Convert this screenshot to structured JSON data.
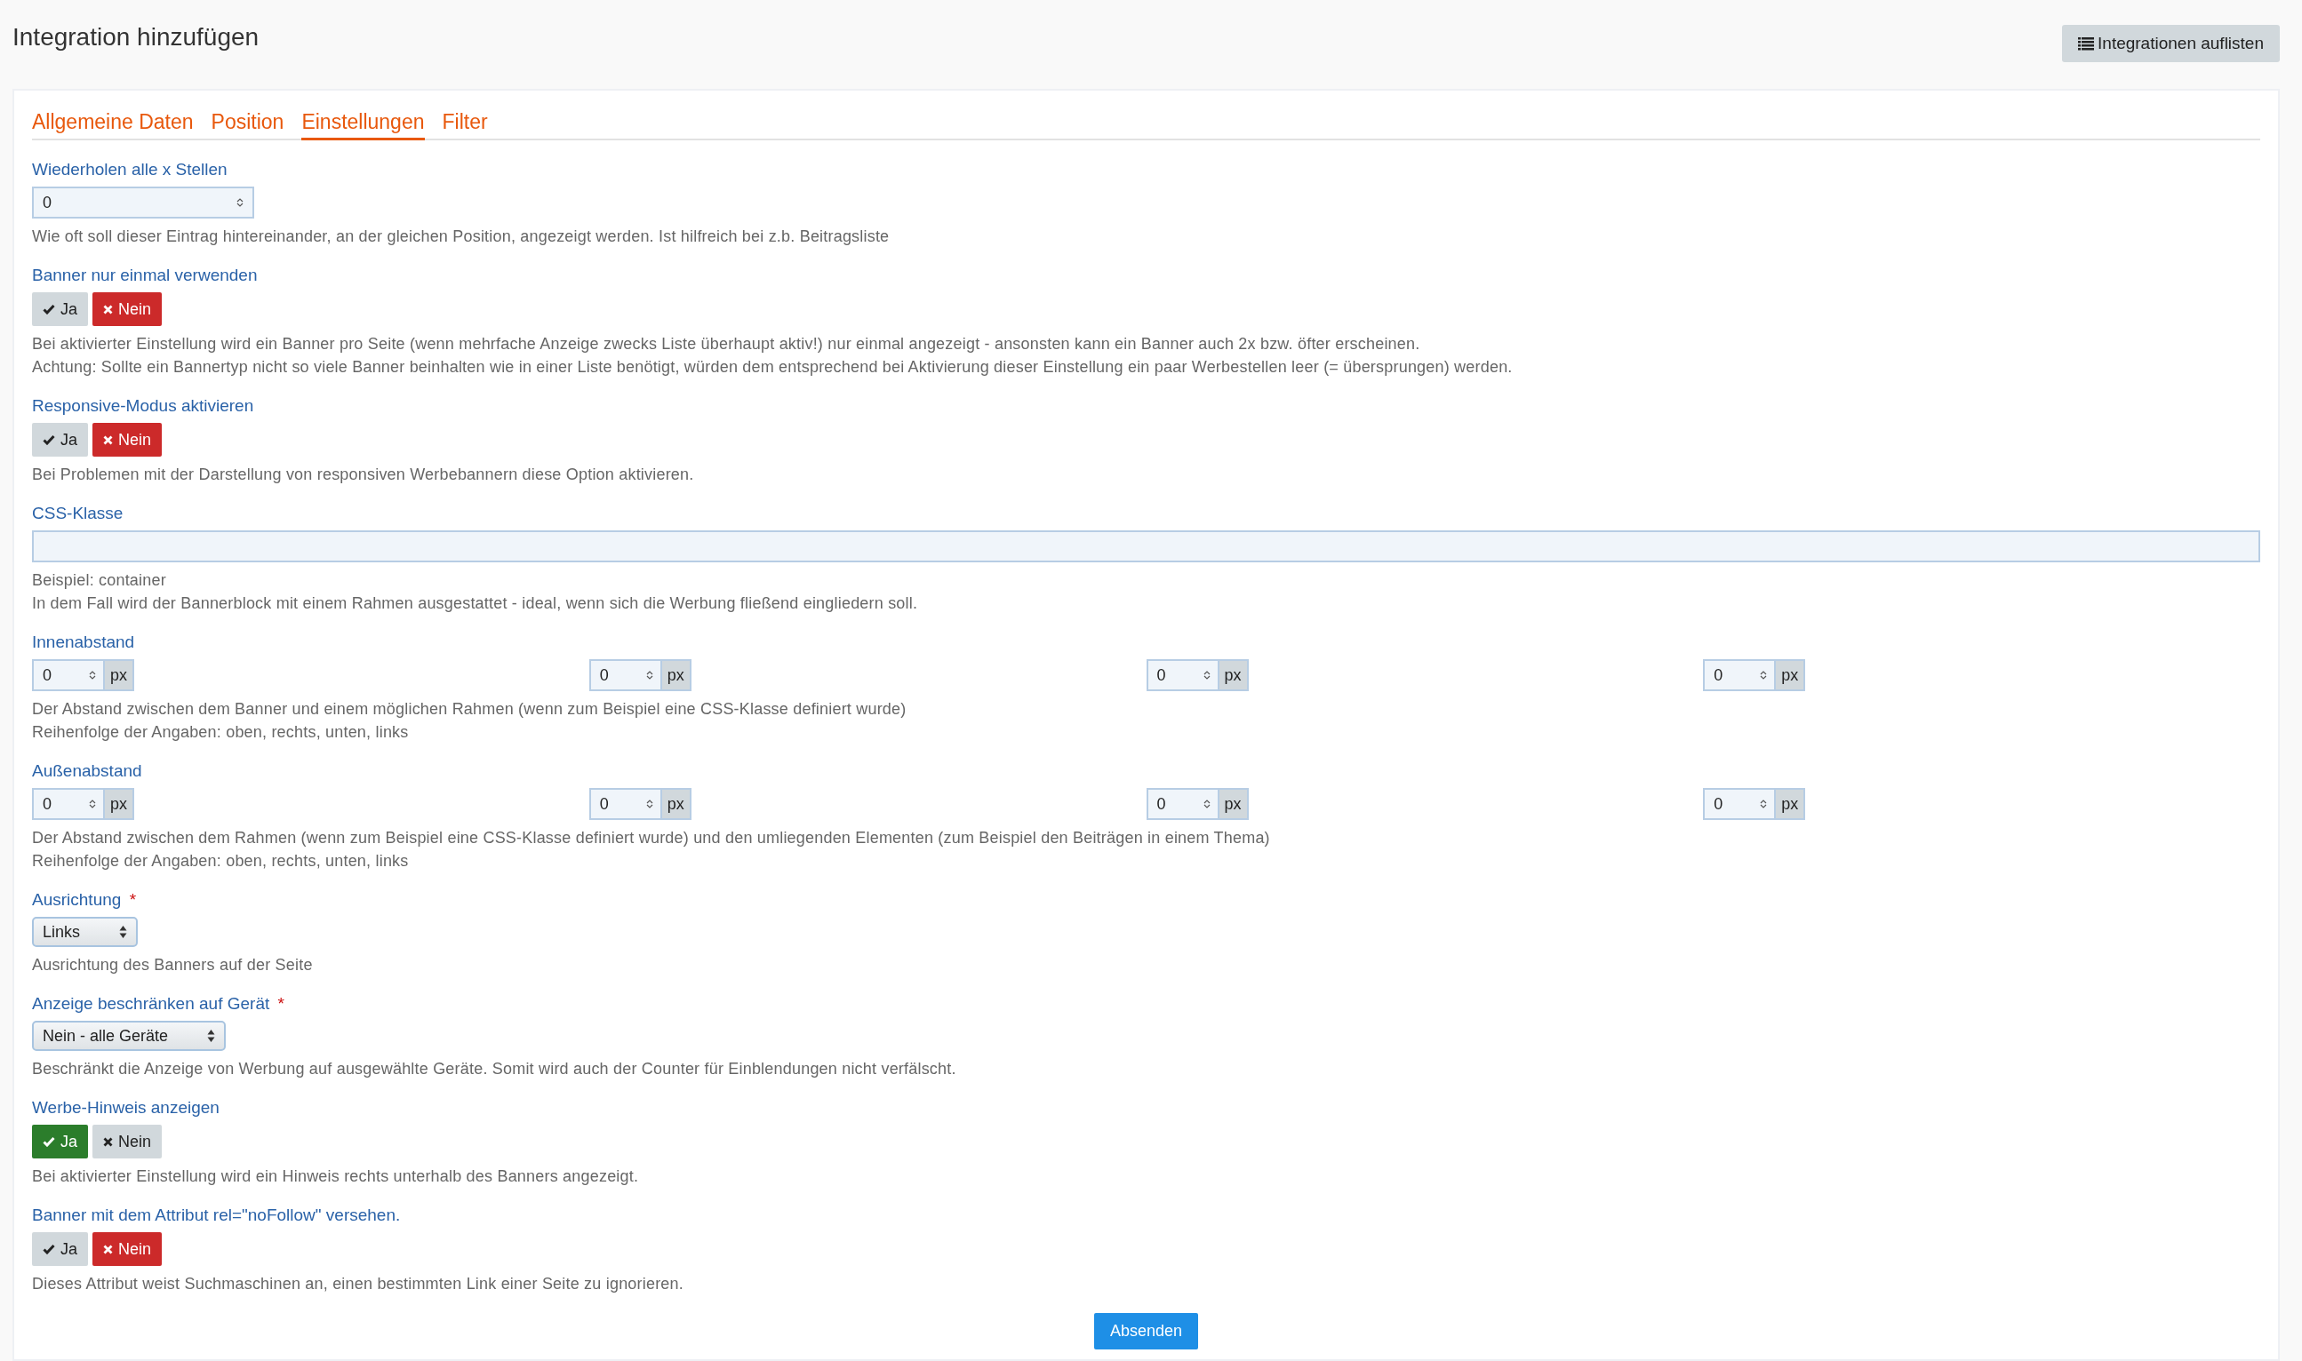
{
  "header": {
    "title": "Integration hinzufügen",
    "list_button": "Integrationen auflisten"
  },
  "tabs": [
    {
      "label": "Allgemeine Daten",
      "selected": false
    },
    {
      "label": "Position",
      "selected": false
    },
    {
      "label": "Einstellungen",
      "selected": true
    },
    {
      "label": "Filter",
      "selected": false
    }
  ],
  "fields": [
    {
      "kind": "number",
      "label": "Wiederholen alle x Stellen",
      "value": "0",
      "help": [
        "Wie oft soll dieser Eintrag hintereinander, an der gleichen Position, angezeigt werden. Ist hilfreich bei z.b. Beitragsliste"
      ]
    },
    {
      "kind": "toggle",
      "label": "Banner nur einmal verwenden",
      "options": [
        {
          "label": "Ja",
          "kind": "yes",
          "selected": false
        },
        {
          "label": "Nein",
          "kind": "no",
          "selected": true
        }
      ],
      "help": [
        "Bei aktivierter Einstellung wird ein Banner pro Seite (wenn mehrfache Anzeige zwecks Liste überhaupt aktiv!) nur einmal angezeigt - ansonsten kann ein Banner auch 2x bzw. öfter erscheinen.",
        "Achtung: Sollte ein Bannertyp nicht so viele Banner beinhalten wie in einer Liste benötigt, würden dem entsprechend bei Aktivierung dieser Einstellung ein paar Werbestellen leer (= übersprungen) werden."
      ]
    },
    {
      "kind": "toggle",
      "label": "Responsive-Modus aktivieren",
      "options": [
        {
          "label": "Ja",
          "kind": "yes",
          "selected": false
        },
        {
          "label": "Nein",
          "kind": "no",
          "selected": true
        }
      ],
      "help": [
        "Bei Problemen mit der Darstellung von responsiven Werbebannern diese Option aktivieren."
      ]
    },
    {
      "kind": "text",
      "label": "CSS-Klasse",
      "help": [
        "Beispiel: container",
        "In dem Fall wird der Bannerblock mit einem Rahmen ausgestattet - ideal, wenn sich die Werbung fließend eingliedern soll."
      ]
    },
    {
      "kind": "quad",
      "label": "Innenabstand",
      "inputs": [
        {
          "value": "0",
          "unit": "px"
        },
        {
          "value": "0",
          "unit": "px"
        },
        {
          "value": "0",
          "unit": "px"
        },
        {
          "value": "0",
          "unit": "px"
        }
      ],
      "help": [
        "Der Abstand zwischen dem Banner und einem möglichen Rahmen (wenn zum Beispiel eine CSS-Klasse definiert wurde)",
        "Reihenfolge der Angaben: oben, rechts, unten, links"
      ]
    },
    {
      "kind": "quad",
      "label": "Außenabstand",
      "inputs": [
        {
          "value": "0",
          "unit": "px"
        },
        {
          "value": "0",
          "unit": "px"
        },
        {
          "value": "0",
          "unit": "px"
        },
        {
          "value": "0",
          "unit": "px"
        }
      ],
      "help": [
        "Der Abstand zwischen dem Rahmen (wenn zum Beispiel eine CSS-Klasse definiert wurde) und den umliegenden Elementen (zum Beispiel den Beiträgen in einem Thema)",
        "Reihenfolge der Angaben: oben, rechts, unten, links"
      ]
    },
    {
      "kind": "select",
      "label": "Ausrichtung",
      "required_mark": "*",
      "value": "Links",
      "help": [
        "Ausrichtung des Banners auf der Seite"
      ]
    },
    {
      "kind": "select",
      "label": "Anzeige beschränken auf Gerät",
      "required_mark": "*",
      "value": "Nein - alle Geräte",
      "help": [
        "Beschränkt die Anzeige von Werbung auf ausgewählte Geräte. Somit wird auch der Counter für Einblendungen nicht verfälscht."
      ]
    },
    {
      "kind": "toggle",
      "label": "Werbe-Hinweis anzeigen",
      "options": [
        {
          "label": "Ja",
          "kind": "yes",
          "selected": true
        },
        {
          "label": "Nein",
          "kind": "no",
          "selected": false
        }
      ],
      "help": [
        "Bei aktivierter Einstellung wird ein Hinweis rechts unterhalb des Banners angezeigt."
      ]
    },
    {
      "kind": "toggle",
      "label": "Banner mit dem Attribut rel=\"noFollow\" versehen.",
      "options": [
        {
          "label": "Ja",
          "kind": "yes",
          "selected": false
        },
        {
          "label": "Nein",
          "kind": "no",
          "selected": true
        }
      ],
      "help": [
        "Dieses Attribut weist Suchmaschinen an, einen bestimmten Link einer Seite zu ignorieren."
      ]
    }
  ],
  "submit": "Absenden"
}
